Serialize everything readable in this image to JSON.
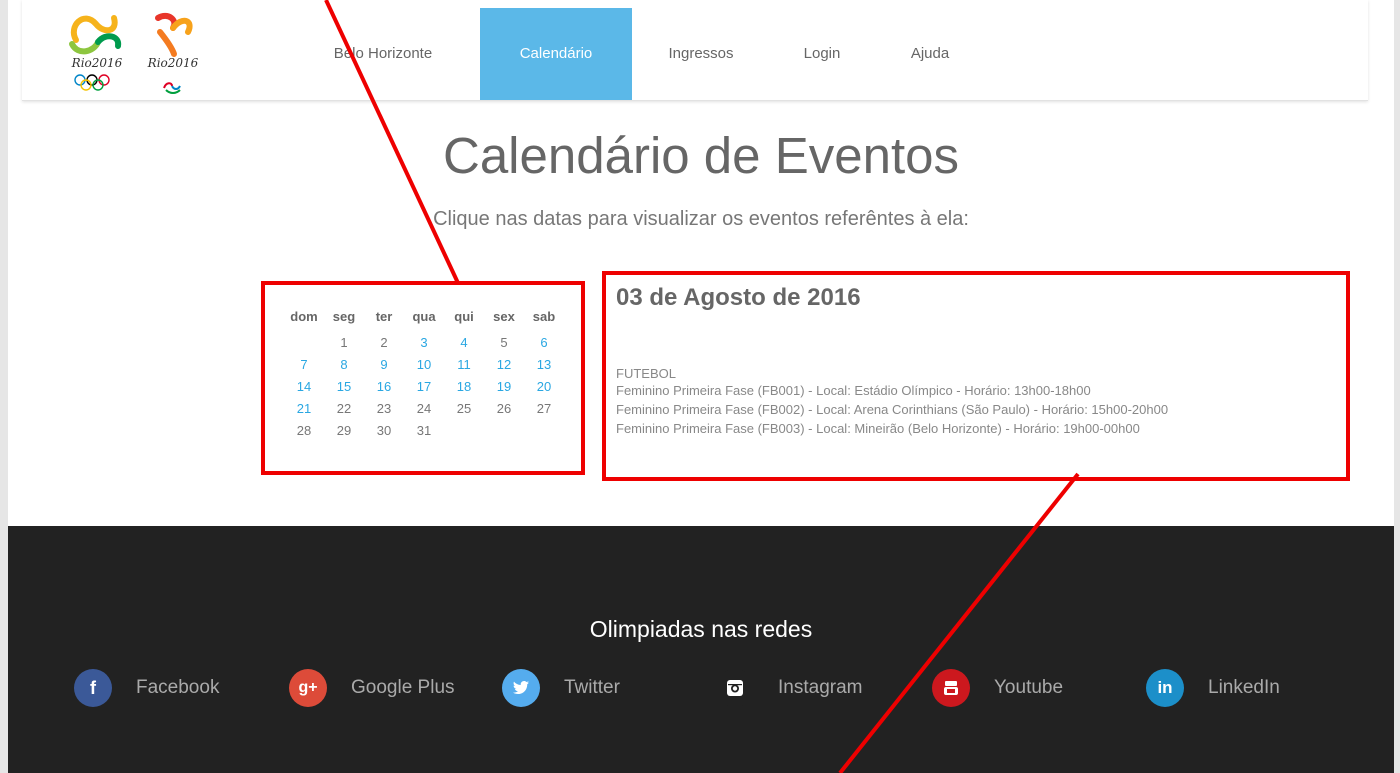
{
  "nav": {
    "logos": {
      "olympic_text": "Rio2016",
      "paralympic_text": "Rio2016"
    },
    "items": [
      {
        "label": "Belo Horizonte"
      },
      {
        "label": "Calendário",
        "active": true
      },
      {
        "label": "Ingressos"
      },
      {
        "label": "Login"
      },
      {
        "label": "Ajuda"
      }
    ],
    "active_color": "#5bb8e8"
  },
  "main": {
    "title": "Calendário de Eventos",
    "subtitle": "Clique nas datas para visualizar os eventos referêntes à ela:"
  },
  "calendar": {
    "weekdays": [
      "dom",
      "seg",
      "ter",
      "qua",
      "qui",
      "sex",
      "sab"
    ],
    "weeks": [
      [
        "",
        "1",
        "2",
        "3",
        "4",
        "5",
        "6"
      ],
      [
        "7",
        "8",
        "9",
        "10",
        "11",
        "12",
        "13"
      ],
      [
        "14",
        "15",
        "16",
        "17",
        "18",
        "19",
        "20"
      ],
      [
        "21",
        "22",
        "23",
        "24",
        "25",
        "26",
        "27"
      ],
      [
        "28",
        "29",
        "30",
        "31",
        "",
        "",
        ""
      ]
    ],
    "event_days": [
      "3",
      "4",
      "6",
      "7",
      "8",
      "9",
      "10",
      "11",
      "12",
      "13",
      "14",
      "15",
      "16",
      "17",
      "18",
      "19",
      "20",
      "21"
    ],
    "event_color": "#2aa7e2"
  },
  "events": {
    "date": "03 de Agosto de 2016",
    "sport": "FUTEBOL",
    "items": [
      "Feminino Primeira Fase (FB001) - Local: Estádio Olímpico - Horário: 13h00-18h00",
      "Feminino Primeira Fase (FB002) - Local: Arena Corinthians (São Paulo) - Horário: 15h00-20h00",
      "Feminino Primeira Fase (FB003) - Local: Mineirão (Belo Horizonte) - Horário: 19h00-00h00"
    ]
  },
  "footer": {
    "title": "Olimpiadas nas redes",
    "social": [
      {
        "label": "Facebook",
        "icon": "facebook-icon",
        "color": "#3b5998"
      },
      {
        "label": "Google Plus",
        "icon": "google-plus-icon",
        "color": "#dd4b39"
      },
      {
        "label": "Twitter",
        "icon": "twitter-icon",
        "color": "#55acee"
      },
      {
        "label": "Instagram",
        "icon": "instagram-icon",
        "color": "#222222"
      },
      {
        "label": "Youtube",
        "icon": "youtube-icon",
        "color": "#cc181e"
      },
      {
        "label": "LinkedIn",
        "icon": "linkedin-icon",
        "color": "#1c8fc9"
      }
    ]
  },
  "annotation": {
    "color": "#ee0000"
  }
}
